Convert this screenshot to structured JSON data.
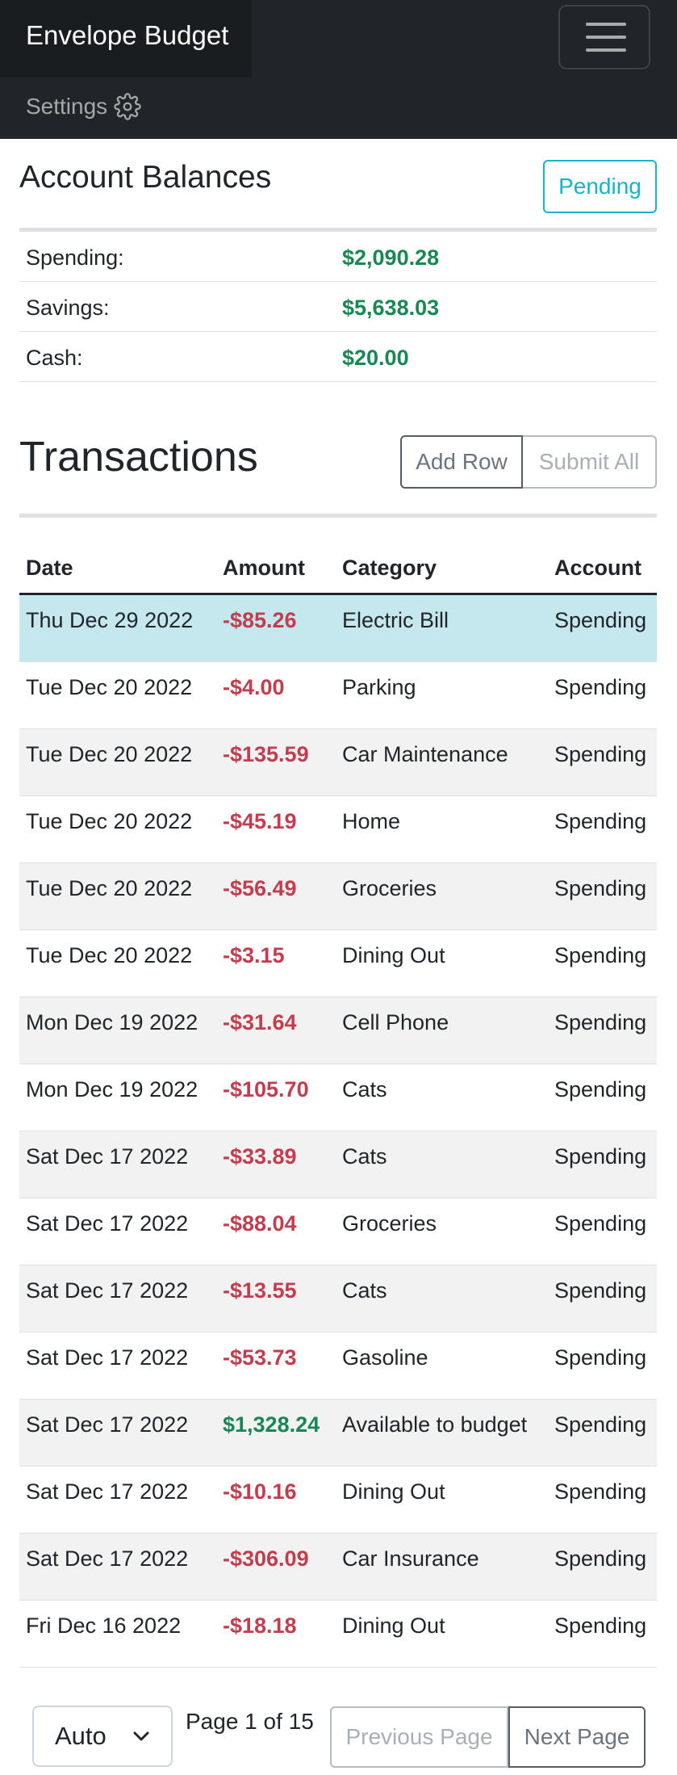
{
  "navbar": {
    "brand": "Envelope Budget",
    "settings_label": "Settings"
  },
  "accounts": {
    "title": "Account Balances",
    "pending_label": "Pending",
    "rows": [
      {
        "label": "Spending:",
        "value": "$2,090.28"
      },
      {
        "label": "Savings:",
        "value": "$5,638.03"
      },
      {
        "label": "Cash:",
        "value": "$20.00"
      }
    ]
  },
  "transactions": {
    "title": "Transactions",
    "add_row_label": "Add Row",
    "submit_all_label": "Submit All",
    "columns": [
      "Date",
      "Amount",
      "Category",
      "Account"
    ],
    "rows": [
      {
        "date": "Thu Dec 29 2022",
        "amount": "-$85.26",
        "category": "Electric Bill",
        "account": "Spending"
      },
      {
        "date": "Tue Dec 20 2022",
        "amount": "-$4.00",
        "category": "Parking",
        "account": "Spending"
      },
      {
        "date": "Tue Dec 20 2022",
        "amount": "-$135.59",
        "category": "Car Maintenance",
        "account": "Spending"
      },
      {
        "date": "Tue Dec 20 2022",
        "amount": "-$45.19",
        "category": "Home",
        "account": "Spending"
      },
      {
        "date": "Tue Dec 20 2022",
        "amount": "-$56.49",
        "category": "Groceries",
        "account": "Spending"
      },
      {
        "date": "Tue Dec 20 2022",
        "amount": "-$3.15",
        "category": "Dining Out",
        "account": "Spending"
      },
      {
        "date": "Mon Dec 19 2022",
        "amount": "-$31.64",
        "category": "Cell Phone",
        "account": "Spending"
      },
      {
        "date": "Mon Dec 19 2022",
        "amount": "-$105.70",
        "category": "Cats",
        "account": "Spending"
      },
      {
        "date": "Sat Dec 17 2022",
        "amount": "-$33.89",
        "category": "Cats",
        "account": "Spending"
      },
      {
        "date": "Sat Dec 17 2022",
        "amount": "-$88.04",
        "category": "Groceries",
        "account": "Spending"
      },
      {
        "date": "Sat Dec 17 2022",
        "amount": "-$13.55",
        "category": "Cats",
        "account": "Spending"
      },
      {
        "date": "Sat Dec 17 2022",
        "amount": "-$53.73",
        "category": "Gasoline",
        "account": "Spending"
      },
      {
        "date": "Sat Dec 17 2022",
        "amount": "$1,328.24",
        "category": "Available to budget",
        "account": "Spending"
      },
      {
        "date": "Sat Dec 17 2022",
        "amount": "-$10.16",
        "category": "Dining Out",
        "account": "Spending"
      },
      {
        "date": "Sat Dec 17 2022",
        "amount": "-$306.09",
        "category": "Car Insurance",
        "account": "Spending"
      },
      {
        "date": "Fri Dec 16 2022",
        "amount": "-$18.18",
        "category": "Dining Out",
        "account": "Spending"
      }
    ]
  },
  "pagination": {
    "page_size_value": "Auto",
    "page_info": "Page 1 of 15",
    "previous_label": "Previous Page",
    "next_label": "Next Page"
  },
  "colors": {
    "navbar_bg": "#212529",
    "positive": "#198754",
    "negative": "#c43d4e",
    "info": "#17b4c9",
    "selected_row": "#c5e8ee"
  }
}
